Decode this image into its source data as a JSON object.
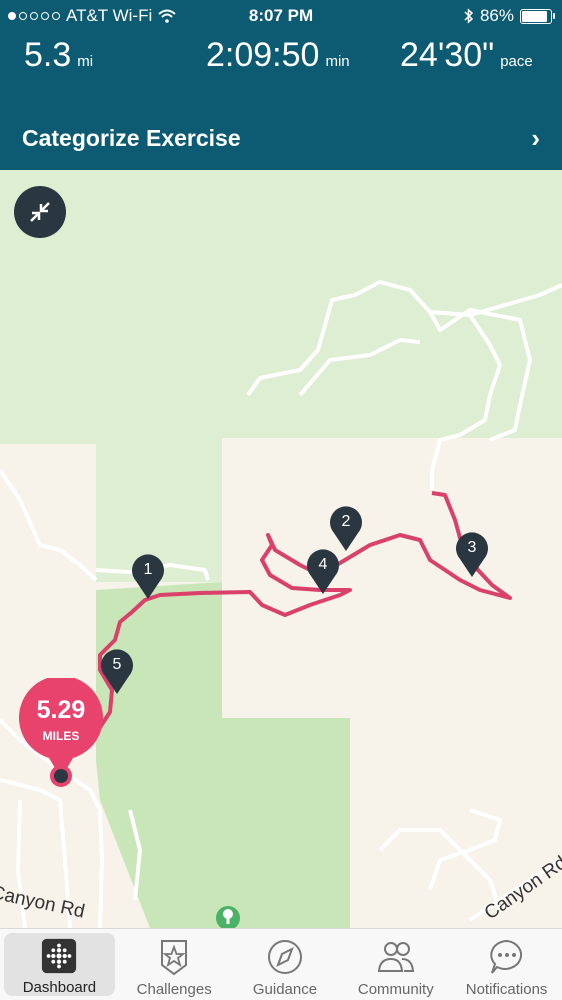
{
  "status": {
    "carrier": "AT&T Wi-Fi",
    "time": "8:07 PM",
    "battery": "86%"
  },
  "stats": {
    "distance": {
      "value": "5.3",
      "unit": "mi"
    },
    "duration": {
      "value": "2:09:50",
      "unit": "min"
    },
    "pace": {
      "value": "24'30\"",
      "unit": "pace"
    }
  },
  "categorize": {
    "label": "Categorize Exercise"
  },
  "map": {
    "total_badge": {
      "value": "5.29",
      "unit": "MILES"
    },
    "markers": [
      "1",
      "2",
      "3",
      "4",
      "5"
    ],
    "road_labels": [
      "Canyon Rd",
      "Canyon Rd"
    ]
  },
  "tabs": [
    {
      "label": "Dashboard",
      "icon": "dashboard-icon",
      "active": true
    },
    {
      "label": "Challenges",
      "icon": "challenges-star-icon"
    },
    {
      "label": "Guidance",
      "icon": "guidance-compass-icon"
    },
    {
      "label": "Community",
      "icon": "community-people-icon"
    },
    {
      "label": "Notifications",
      "icon": "notifications-chat-icon"
    }
  ],
  "colors": {
    "header": "#0d5a73",
    "route": "#d9406a",
    "badge": "#e8436d",
    "marker": "#2a3640",
    "park": "#cfe8c2"
  }
}
